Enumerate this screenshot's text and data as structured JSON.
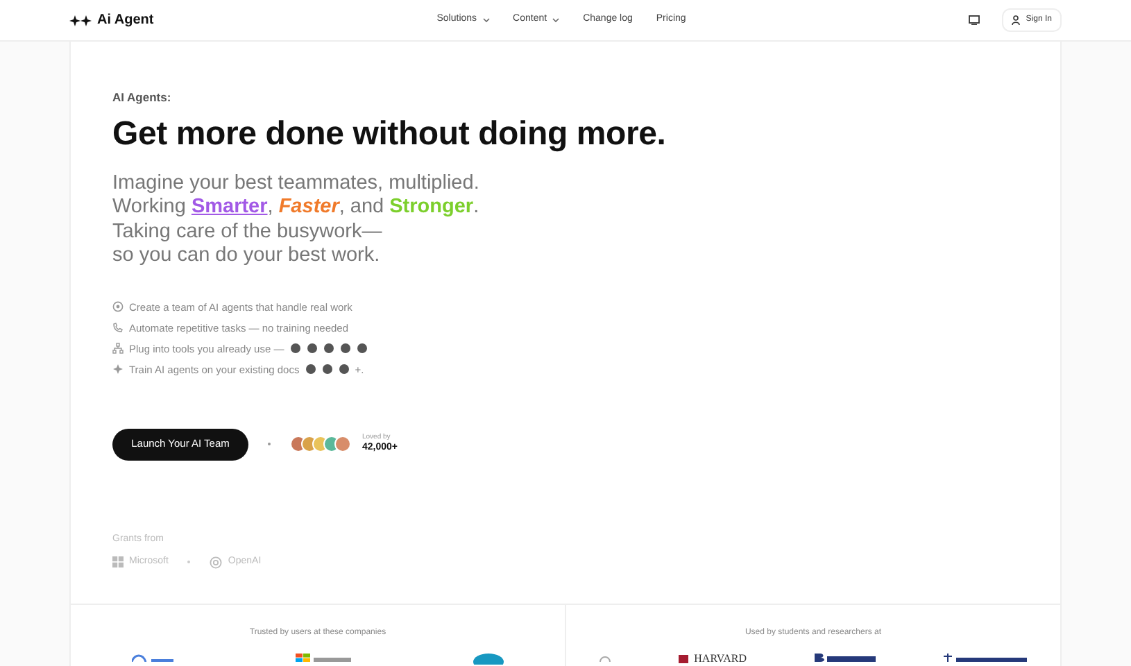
{
  "brand": {
    "name": "Ai Agent"
  },
  "nav": [
    {
      "label": "Solutions",
      "dropdown": true
    },
    {
      "label": "Content",
      "dropdown": true
    },
    {
      "label": "Change log",
      "dropdown": false
    },
    {
      "label": "Pricing",
      "dropdown": false
    }
  ],
  "sign_in": "Sign In",
  "hero": {
    "eyebrow": "AI Agents:",
    "title": "Get more done without doing more.",
    "lines": [
      [
        {
          "text": "Imagine your best teammates, multiplied.",
          "kind": "plain"
        }
      ],
      [
        {
          "text": "Working ",
          "kind": "plain"
        },
        {
          "text": "Smarter",
          "kind": "underline",
          "color": "#a259e6"
        },
        {
          "text": ", ",
          "kind": "plain"
        },
        {
          "text": "Faster",
          "kind": "italic",
          "color": "#f07a2a"
        },
        {
          "text": ", and ",
          "kind": "plain"
        },
        {
          "text": "Stronger",
          "kind": "bold",
          "color": "#7ccf2c"
        },
        {
          "text": ".",
          "kind": "plain"
        }
      ],
      [
        {
          "text": "Taking care of the busywork—",
          "kind": "plain"
        }
      ],
      [
        {
          "text": "so you can do your best work.",
          "kind": "plain"
        }
      ]
    ]
  },
  "features": [
    {
      "kind": "target",
      "text": "Create a team of AI agents that handle real work"
    },
    {
      "kind": "phone",
      "text": "Automate repetitive tasks — no training needed"
    },
    {
      "kind": "network",
      "text": "Plug into tools you already use —"
    },
    {
      "kind": "sparkle",
      "text": "Train AI agents on your existing docs",
      "suffix": "+."
    }
  ],
  "cta": {
    "label": "Launch Your AI Team",
    "loved_by": "Loved by",
    "count": "42,000+"
  },
  "grants": {
    "label": "Grants from",
    "names": [
      "Microsoft",
      "OpenAI"
    ]
  },
  "bottom": [
    {
      "caption": "Trusted by users at these companies",
      "kind": "companies"
    },
    {
      "caption": "Used by students and researchers at",
      "kind": "universities",
      "name": "HARVARD"
    }
  ]
}
